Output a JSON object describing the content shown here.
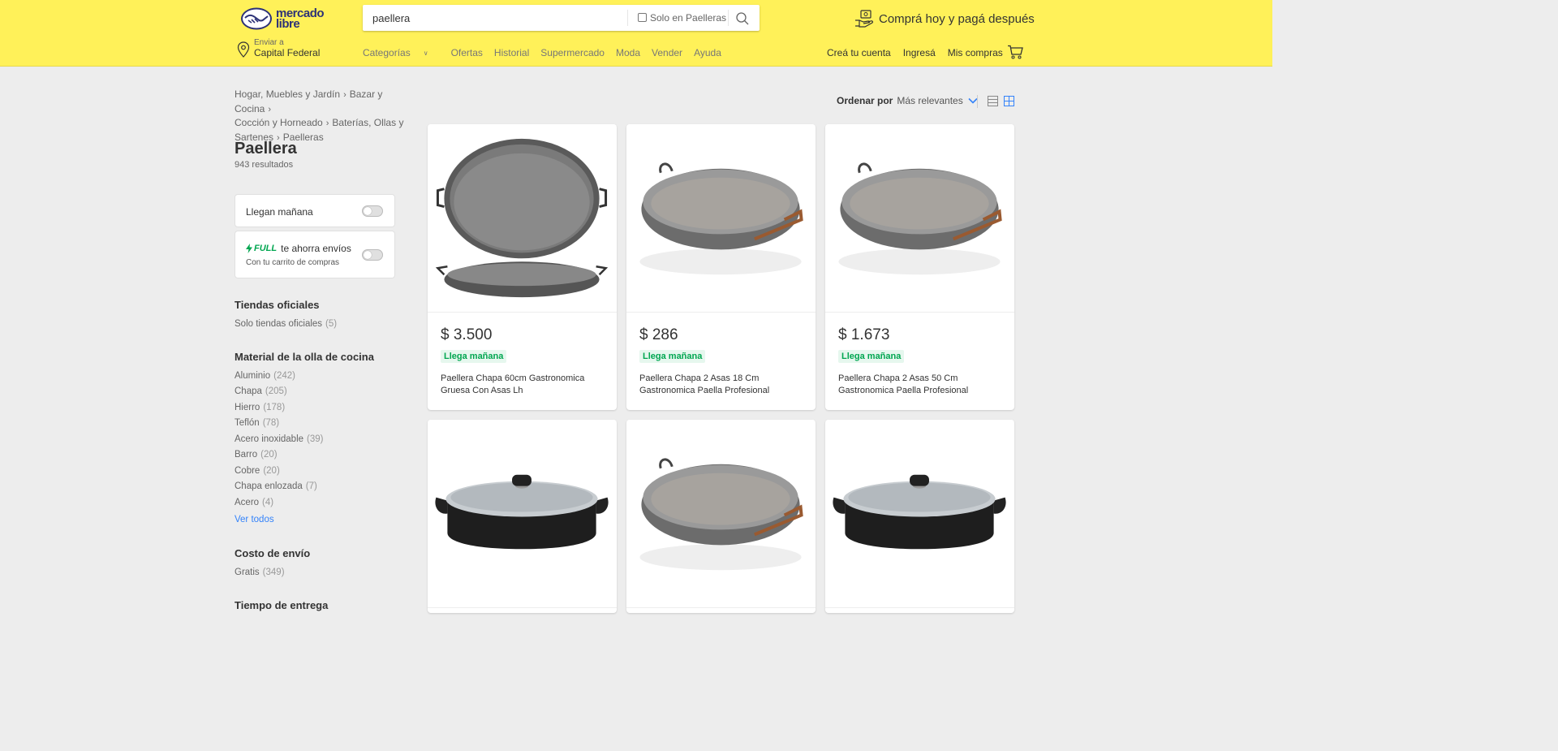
{
  "brand": {
    "line1": "mercado",
    "line2": "libre"
  },
  "search": {
    "value": "paellera",
    "solo_label": "Solo en Paelleras"
  },
  "promo": "Comprá hoy y pagá después",
  "location": {
    "small": "Enviar a",
    "city": "Capital Federal"
  },
  "nav": [
    "Categorías",
    "Ofertas",
    "Historial",
    "Supermercado",
    "Moda",
    "Vender",
    "Ayuda"
  ],
  "account": [
    "Creá tu cuenta",
    "Ingresá",
    "Mis compras"
  ],
  "breadcrumb": {
    "c1": "Hogar, Muebles y Jardín",
    "c2": "Bazar y Cocina",
    "c3": "Cocción y Horneado",
    "c4": "Baterías, Ollas y Sartenes",
    "c5": "Paelleras"
  },
  "page": {
    "title": "Paellera",
    "count": "943 resultados"
  },
  "filters": {
    "llegan": "Llegan mañana",
    "full_badge": "FULL",
    "full_text": "te ahorra envíos",
    "full_sub": "Con tu carrito de compras"
  },
  "tiendas": {
    "title": "Tiendas oficiales",
    "item": "Solo tiendas oficiales",
    "qty": "(5)"
  },
  "material": {
    "title": "Material de la olla de cocina",
    "items": [
      {
        "label": "Aluminio",
        "qty": "(242)"
      },
      {
        "label": "Chapa",
        "qty": "(205)"
      },
      {
        "label": "Hierro",
        "qty": "(178)"
      },
      {
        "label": "Teflón",
        "qty": "(78)"
      },
      {
        "label": "Acero inoxidable",
        "qty": "(39)"
      },
      {
        "label": "Barro",
        "qty": "(20)"
      },
      {
        "label": "Cobre",
        "qty": "(20)"
      },
      {
        "label": "Chapa enlozada",
        "qty": "(7)"
      },
      {
        "label": "Acero",
        "qty": "(4)"
      }
    ],
    "see_all": "Ver todos"
  },
  "envio": {
    "title": "Costo de envío",
    "item": "Gratis",
    "qty": "(349)"
  },
  "entrega": {
    "title": "Tiempo de entrega"
  },
  "sort": {
    "label": "Ordenar por",
    "value": "Más relevantes"
  },
  "products": [
    {
      "price": "$ 3.500",
      "badge": "Llega mañana",
      "title": "Paellera Chapa 60cm Gastronomica Gruesa Con Asas Lh"
    },
    {
      "price": "$ 286",
      "badge": "Llega mañana",
      "title": "Paellera Chapa 2 Asas 18 Cm Gastronomica Paella Profesional"
    },
    {
      "price": "$ 1.673",
      "badge": "Llega mañana",
      "title": "Paellera Chapa 2 Asas 50 Cm Gastronomica Paella Profesional"
    }
  ],
  "colors": {
    "header": "#fff159",
    "accent": "#3483fa",
    "success": "#00a650"
  }
}
